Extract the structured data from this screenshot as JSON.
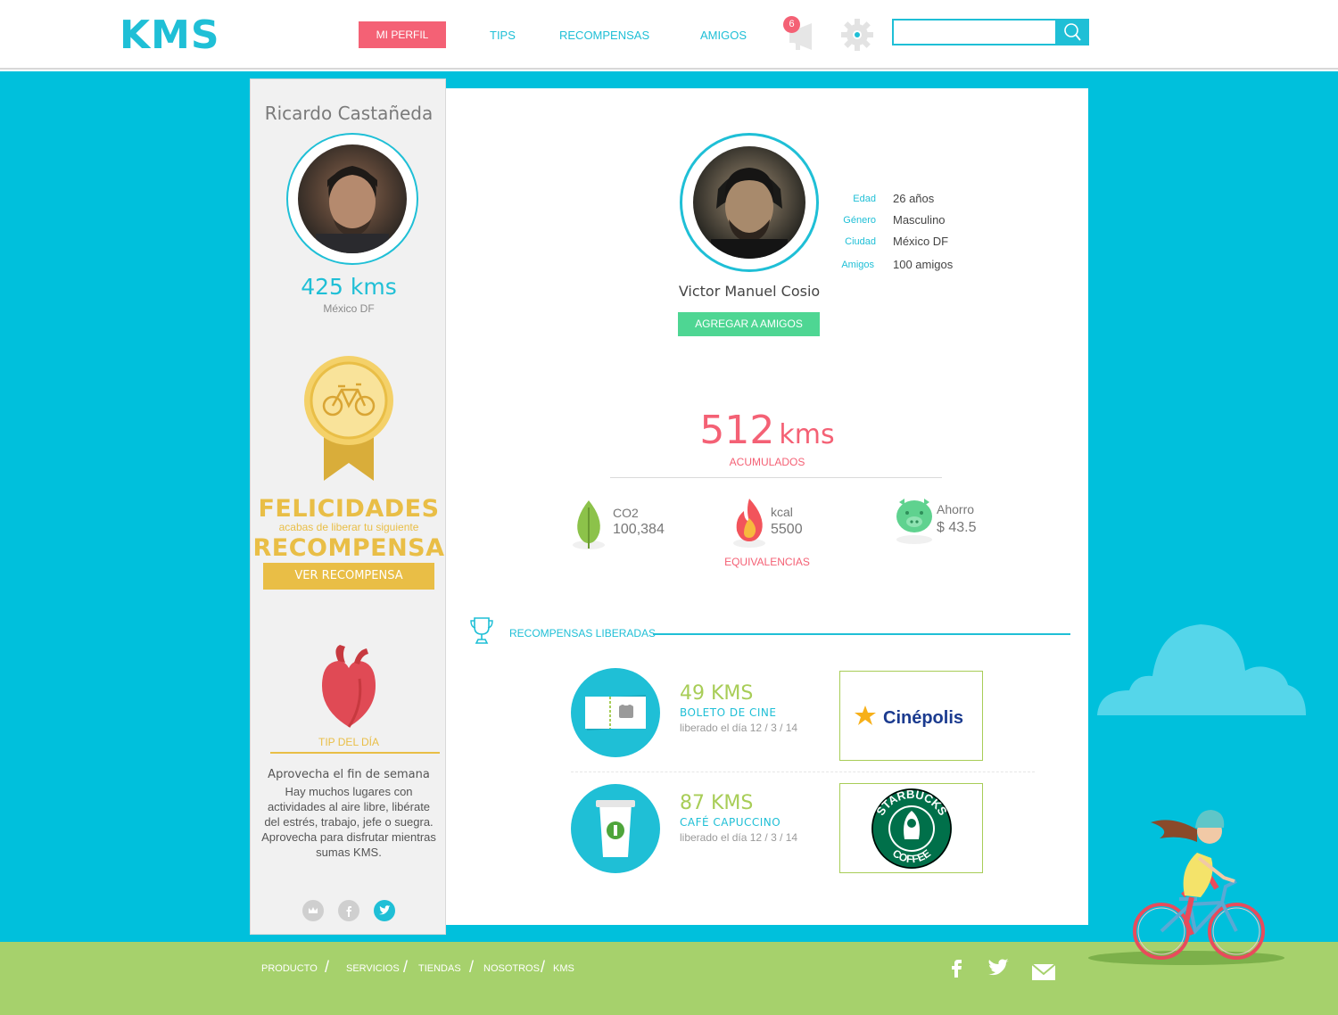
{
  "header": {
    "logo": "KMS",
    "nav": {
      "active": "MI PERFIL",
      "tips": "TIPS",
      "rewards": "RECOMPENSAS",
      "friends": "AMIGOS"
    },
    "notification_count": "6",
    "search": {
      "value": "",
      "placeholder": ""
    }
  },
  "sidebar": {
    "user_name": "Ricardo Castañeda",
    "kms": "425 kms",
    "city": "México DF",
    "congrats_title": "FELICIDADES",
    "congrats_sub": "acabas de liberar tu siguiente",
    "congrats_reward": "RECOMPENSA",
    "view_reward_button": "VER RECOMPENSA",
    "tip_label": "TIP DEL DÍA",
    "tip_title": "Aprovecha el fin de semana",
    "tip_body": "Hay muchos lugares con actividades al aire libre, libérate del estrés, trabajo, jefe o suegra. Aprovecha para disfrutar mientras sumas KMS."
  },
  "profile": {
    "name": "Victor Manuel Cosio",
    "add_friend_button": "AGREGAR A AMIGOS",
    "info": [
      {
        "label": "Edad",
        "value": "26 años"
      },
      {
        "label": "Género",
        "value": "Masculino"
      },
      {
        "label": "Ciudad",
        "value": "México DF"
      },
      {
        "label": "Amigos",
        "value": "100 amigos"
      }
    ]
  },
  "stats": {
    "kms_value": "512",
    "kms_unit": "kms",
    "accumulated_label": "ACUMULADOS",
    "equivalences_label": "EQUIVALENCIAS",
    "equivalences": [
      {
        "label": "CO2",
        "value": "100,384",
        "icon": "leaf-icon"
      },
      {
        "label": "kcal",
        "value": "5500",
        "icon": "flame-icon"
      },
      {
        "label": "Ahorro",
        "value": "$ 43.5",
        "icon": "piggy-bank-icon"
      }
    ]
  },
  "rewards": {
    "section_title": "RECOMPENSAS LIBERADAS",
    "items": [
      {
        "kms": "49 KMS",
        "name": "BOLETO DE CINE",
        "date": "liberado el día 12 / 3 / 14",
        "icon": "ticket-icon",
        "brand": "Cinépolis"
      },
      {
        "kms": "87 KMS",
        "name": "CAFÉ CAPUCCINO",
        "date": "liberado el día 12 / 3 / 14",
        "icon": "coffee-cup-icon",
        "brand": "STARBUCKS COFFEE"
      }
    ]
  },
  "footer": {
    "links": [
      "PRODUCTO",
      "SERVICIOS",
      "TIENDAS",
      "NOSOTROS",
      "KMS"
    ]
  },
  "colors": {
    "accent": "#1fbfd6",
    "pink": "#f46175",
    "gold": "#e9be46",
    "green": "#4ed693",
    "lime": "#a8cd57",
    "grass": "#a6d16c"
  }
}
